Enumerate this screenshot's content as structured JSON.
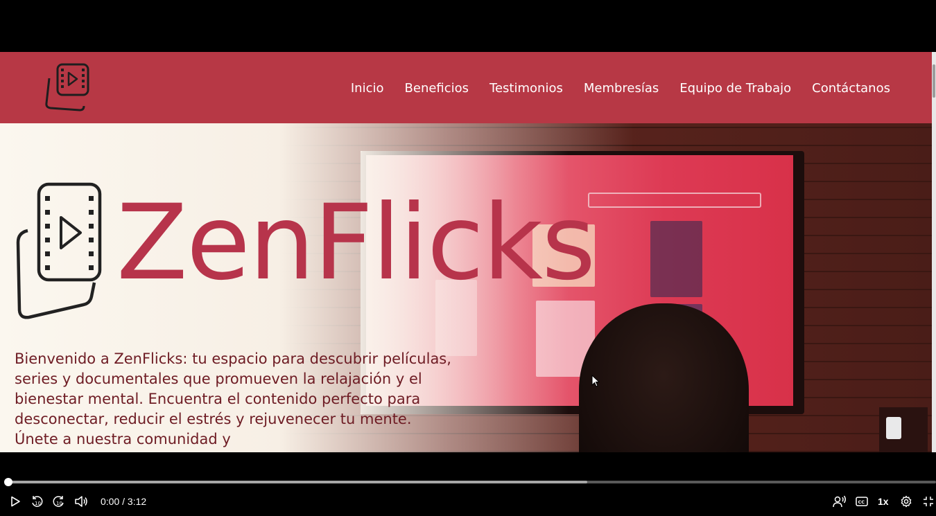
{
  "nav": {
    "items": [
      {
        "label": "Inicio"
      },
      {
        "label": "Beneficios"
      },
      {
        "label": "Testimonios"
      },
      {
        "label": "Membresías"
      },
      {
        "label": "Equipo de Trabajo"
      },
      {
        "label": "Contáctanos"
      }
    ]
  },
  "hero": {
    "brand_name": "ZenFlicks",
    "intro": "Bienvenido a ZenFlicks: tu espacio para descubrir películas, series y documentales que promueven la relajación y el bienestar mental. Encuentra el contenido perfecto para desconectar, reducir el estrés y rejuvenecer tu mente. Únete a nuestra comunidad y"
  },
  "player": {
    "current_time": "0:00",
    "duration": "3:12",
    "time_display": "0:00 / 3:12",
    "speed": "1x",
    "played_fraction": 0.0,
    "buffered_fraction": 0.624,
    "icons": [
      "play-icon",
      "rewind-10-icon",
      "forward-10-icon",
      "volume-icon",
      "transcript-icon",
      "captions-icon",
      "settings-icon",
      "fullscreen-exit-icon"
    ]
  },
  "colors": {
    "brand_red": "#b73845",
    "logo_text_red": "#b7344b",
    "intro_text": "#6e1c24",
    "player_bg": "#000000"
  }
}
